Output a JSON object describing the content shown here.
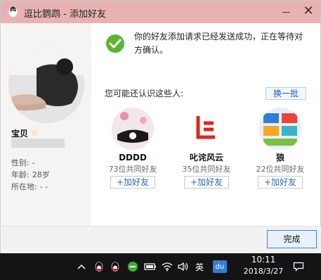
{
  "window": {
    "title": "逗比鹦鹉 - 添加好友",
    "success_message": "你的好友添加请求已经发送成功，正在等待对方确认。",
    "done_label": "完成"
  },
  "profile": {
    "nickname": "宝贝",
    "gender_label": "性别:",
    "gender_value": "-",
    "age_label": "年龄:",
    "age_value": "28岁",
    "location_label": "所在地:",
    "location_value": "-     -"
  },
  "suggestions": {
    "heading": "您可能还认识这些人:",
    "refresh_label": "换一批",
    "add_label": "加好友",
    "people": [
      {
        "name": "DDDD",
        "mutual": "73位共同好友"
      },
      {
        "name": "叱诧风云",
        "mutual": "35位共同好友"
      },
      {
        "name": "狼",
        "mutual": "22位共同好友"
      }
    ]
  },
  "taskbar": {
    "ime_label": "英",
    "du_label": "du",
    "time": "10:11",
    "date": "2018/3/27"
  },
  "colors": {
    "titlebar": "#e9b2b2",
    "accent_blue": "#3c84cf",
    "success_green": "#5cb531",
    "taskbar": "#141416"
  },
  "icons": [
    "penguin-icon",
    "check-circle-icon",
    "star-icon",
    "chevron-up-icon",
    "wechat-icon",
    "battery-icon",
    "wifi-icon",
    "speaker-icon",
    "notification-icon"
  ]
}
